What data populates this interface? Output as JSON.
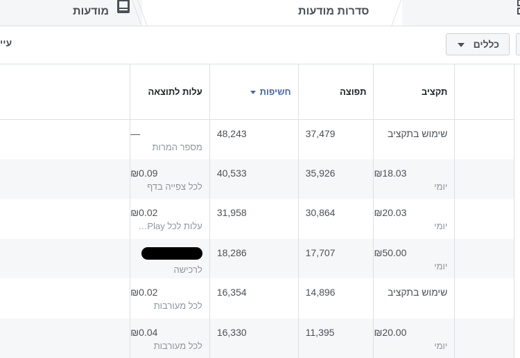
{
  "tabs": [
    {
      "label": "מודעות",
      "icon": "ad-device-icon"
    },
    {
      "label": "סדרות מודעות",
      "icon": "grid-icon",
      "active": true
    }
  ],
  "toolbar": {
    "view_label": "עיי",
    "columns_button": "כללים"
  },
  "table": {
    "headers": {
      "budget": "תקציב",
      "reach": "תפוצה",
      "impressions": "חשיפות",
      "cost_per_result": "עלות לתוצאה"
    },
    "sorted_column": "impressions",
    "rows": [
      {
        "budget_main": "שימוש בתקציב",
        "budget_sub": "",
        "reach": "37,479",
        "impressions": "48,243",
        "cost_main": "—",
        "cost_sub": "מספר המרות"
      },
      {
        "budget_main": "₪18.03",
        "budget_sub": "יומי",
        "reach": "35,926",
        "impressions": "40,533",
        "cost_main": "₪0.09",
        "cost_sub": "לכל צפייה בדף"
      },
      {
        "budget_main": "₪20.03",
        "budget_sub": "יומי",
        "reach": "30,864",
        "impressions": "31,958",
        "cost_main": "₪0.02",
        "cost_sub": "עלות לכל ThruPlay"
      },
      {
        "budget_main": "₪50.00",
        "budget_sub": "יומי",
        "reach": "17,707",
        "impressions": "18,286",
        "cost_main": "",
        "cost_sub": "לרכישה"
      },
      {
        "budget_main": "שימוש בתקציב",
        "budget_sub": "",
        "reach": "14,896",
        "impressions": "16,354",
        "cost_main": "₪0.02",
        "cost_sub": "לכל מעורבות"
      },
      {
        "budget_main": "₪20.00",
        "budget_sub": "יומי",
        "reach": "11,395",
        "impressions": "16,330",
        "cost_main": "₪0.04",
        "cost_sub": "לכל מעורבות"
      }
    ]
  }
}
